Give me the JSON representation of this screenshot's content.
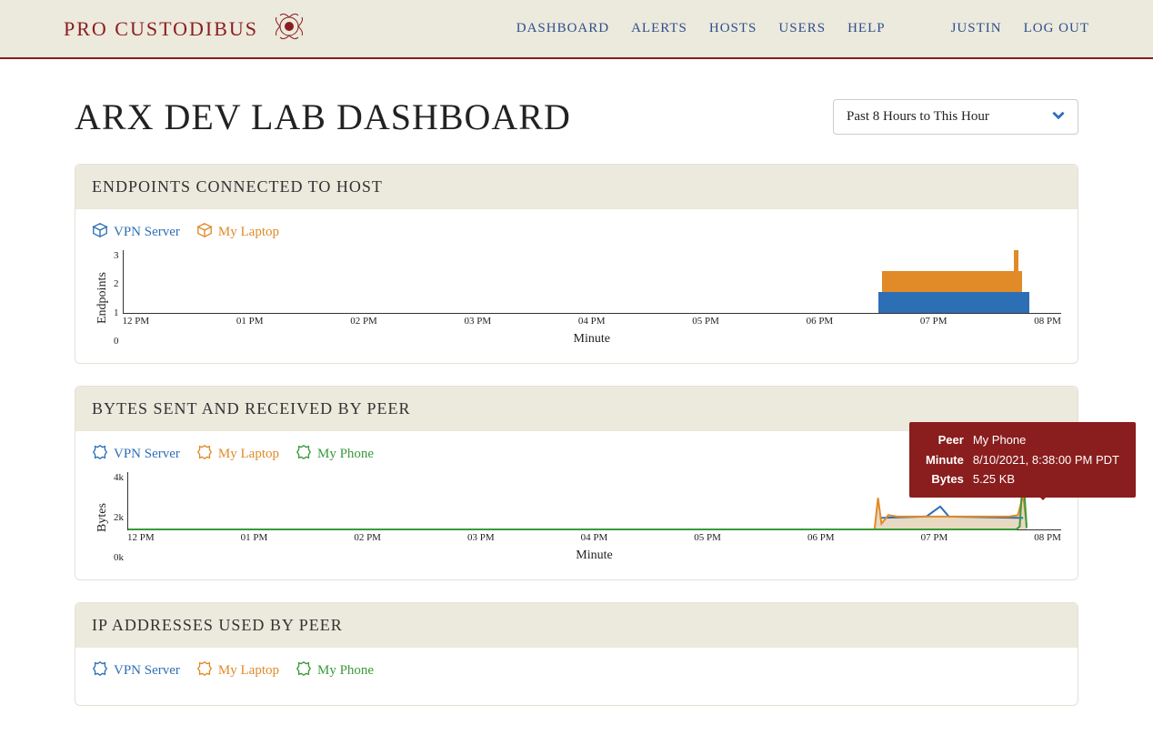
{
  "header": {
    "brand": "PRO CUSTODIBUS",
    "nav": [
      "DASHBOARD",
      "ALERTS",
      "HOSTS",
      "USERS",
      "HELP"
    ],
    "user": "JUSTIN",
    "logout": "LOG OUT"
  },
  "page": {
    "title": "ARX DEV LAB DASHBOARD",
    "range": "Past 8 Hours to This Hour"
  },
  "panels": {
    "endpoints": {
      "title": "ENDPOINTS CONNECTED TO HOST",
      "legend": [
        {
          "label": "VPN Server",
          "color": "blue"
        },
        {
          "label": "My Laptop",
          "color": "orange"
        }
      ]
    },
    "bytes": {
      "title": "BYTES SENT AND RECEIVED BY PEER",
      "legend": [
        {
          "label": "VPN Server",
          "color": "blue"
        },
        {
          "label": "My Laptop",
          "color": "orange"
        },
        {
          "label": "My Phone",
          "color": "green"
        }
      ]
    },
    "ips": {
      "title": "IP ADDRESSES USED BY PEER",
      "legend": [
        {
          "label": "VPN Server",
          "color": "blue"
        },
        {
          "label": "My Laptop",
          "color": "orange"
        },
        {
          "label": "My Phone",
          "color": "green"
        }
      ]
    }
  },
  "tooltip": {
    "peer_label": "Peer",
    "peer_value": "My Phone",
    "minute_label": "Minute",
    "minute_value": "8/10/2021, 8:38:00 PM PDT",
    "bytes_label": "Bytes",
    "bytes_value": "5.25 KB"
  },
  "chart_data": [
    {
      "type": "bar",
      "title": "Endpoints Connected to Host",
      "xlabel": "Minute",
      "ylabel": "Endpoints",
      "ylim": [
        0,
        3
      ],
      "yticks": [
        0,
        1,
        2,
        3
      ],
      "xticks": [
        "12 PM",
        "01 PM",
        "02 PM",
        "03 PM",
        "04 PM",
        "05 PM",
        "06 PM",
        "07 PM",
        "08 PM"
      ],
      "x_minutes": [
        0,
        60,
        120,
        180,
        240,
        300,
        360,
        420,
        480
      ],
      "series": [
        {
          "name": "VPN Server",
          "color": "#2d6fb5",
          "points": [
            {
              "minute": 435,
              "value": 1
            },
            {
              "minute": 437,
              "value": 1
            },
            {
              "minute": 439,
              "value": 1
            },
            {
              "minute": 441,
              "value": 1
            },
            {
              "minute": 443,
              "value": 1
            },
            {
              "minute": 445,
              "value": 1
            },
            {
              "minute": 447,
              "value": 1
            },
            {
              "minute": 449,
              "value": 1
            },
            {
              "minute": 451,
              "value": 1
            },
            {
              "minute": 453,
              "value": 1
            },
            {
              "minute": 455,
              "value": 1
            },
            {
              "minute": 457,
              "value": 1
            },
            {
              "minute": 459,
              "value": 1
            },
            {
              "minute": 461,
              "value": 1
            },
            {
              "minute": 463,
              "value": 1
            },
            {
              "minute": 465,
              "value": 1
            },
            {
              "minute": 467,
              "value": 1
            },
            {
              "minute": 469,
              "value": 1
            },
            {
              "minute": 471,
              "value": 1
            },
            {
              "minute": 473,
              "value": 1
            },
            {
              "minute": 475,
              "value": 1
            },
            {
              "minute": 477,
              "value": 1
            },
            {
              "minute": 479,
              "value": 1
            },
            {
              "minute": 481,
              "value": 1
            },
            {
              "minute": 483,
              "value": 1
            },
            {
              "minute": 485,
              "value": 1
            },
            {
              "minute": 487,
              "value": 1
            },
            {
              "minute": 489,
              "value": 1
            },
            {
              "minute": 491,
              "value": 1
            },
            {
              "minute": 493,
              "value": 1
            },
            {
              "minute": 495,
              "value": 1
            },
            {
              "minute": 497,
              "value": 1
            },
            {
              "minute": 499,
              "value": 1
            },
            {
              "minute": 501,
              "value": 1
            },
            {
              "minute": 503,
              "value": 1
            },
            {
              "minute": 505,
              "value": 1
            },
            {
              "minute": 507,
              "value": 1
            },
            {
              "minute": 509,
              "value": 1
            },
            {
              "minute": 511,
              "value": 1
            },
            {
              "minute": 513,
              "value": 1
            },
            {
              "minute": 515,
              "value": 1
            },
            {
              "minute": 517,
              "value": 1
            },
            {
              "minute": 519,
              "value": 1
            }
          ]
        },
        {
          "name": "My Laptop",
          "color": "#e08a28",
          "points": [
            {
              "minute": 437,
              "value": 1
            },
            {
              "minute": 439,
              "value": 1
            },
            {
              "minute": 441,
              "value": 1
            },
            {
              "minute": 443,
              "value": 1
            },
            {
              "minute": 445,
              "value": 1
            },
            {
              "minute": 447,
              "value": 1
            },
            {
              "minute": 449,
              "value": 1
            },
            {
              "minute": 451,
              "value": 1
            },
            {
              "minute": 453,
              "value": 1
            },
            {
              "minute": 455,
              "value": 1
            },
            {
              "minute": 457,
              "value": 1
            },
            {
              "minute": 459,
              "value": 1
            },
            {
              "minute": 461,
              "value": 1
            },
            {
              "minute": 463,
              "value": 1
            },
            {
              "minute": 465,
              "value": 1
            },
            {
              "minute": 467,
              "value": 1
            },
            {
              "minute": 469,
              "value": 1
            },
            {
              "minute": 471,
              "value": 1
            },
            {
              "minute": 473,
              "value": 1
            },
            {
              "minute": 475,
              "value": 1
            },
            {
              "minute": 477,
              "value": 1
            },
            {
              "minute": 479,
              "value": 1
            },
            {
              "minute": 481,
              "value": 1
            },
            {
              "minute": 483,
              "value": 1
            },
            {
              "minute": 485,
              "value": 1
            },
            {
              "minute": 487,
              "value": 1
            },
            {
              "minute": 489,
              "value": 1
            },
            {
              "minute": 491,
              "value": 1
            },
            {
              "minute": 493,
              "value": 1
            },
            {
              "minute": 495,
              "value": 1
            },
            {
              "minute": 497,
              "value": 1
            },
            {
              "minute": 499,
              "value": 1
            },
            {
              "minute": 501,
              "value": 1
            },
            {
              "minute": 503,
              "value": 1
            },
            {
              "minute": 505,
              "value": 1
            },
            {
              "minute": 507,
              "value": 1
            },
            {
              "minute": 509,
              "value": 1
            },
            {
              "minute": 511,
              "value": 1
            },
            {
              "minute": 513,
              "value": 2
            },
            {
              "minute": 515,
              "value": 1
            }
          ]
        }
      ]
    },
    {
      "type": "area",
      "title": "Bytes Sent and Received by Peer",
      "xlabel": "Minute",
      "ylabel": "Bytes",
      "ylim": [
        0,
        4000
      ],
      "yticks": [
        "0k",
        "2k",
        "4k"
      ],
      "xticks": [
        "12 PM",
        "01 PM",
        "02 PM",
        "03 PM",
        "04 PM",
        "05 PM",
        "06 PM",
        "07 PM",
        "08 PM"
      ],
      "x_minutes": [
        0,
        60,
        120,
        180,
        240,
        300,
        360,
        420,
        480
      ],
      "series": [
        {
          "name": "VPN Server",
          "color": "#2d6fb5",
          "points": [
            {
              "minute": 435,
              "value": 800
            },
            {
              "minute": 462,
              "value": 900
            },
            {
              "minute": 470,
              "value": 1600
            },
            {
              "minute": 475,
              "value": 900
            },
            {
              "minute": 518,
              "value": 800
            }
          ]
        },
        {
          "name": "My Laptop",
          "color": "#e08a28",
          "points": [
            {
              "minute": 432,
              "value": 0
            },
            {
              "minute": 434,
              "value": 2200
            },
            {
              "minute": 436,
              "value": 400
            },
            {
              "minute": 440,
              "value": 1000
            },
            {
              "minute": 445,
              "value": 900
            },
            {
              "minute": 510,
              "value": 900
            },
            {
              "minute": 515,
              "value": 1000
            },
            {
              "minute": 518,
              "value": 2400
            },
            {
              "minute": 520,
              "value": 300
            }
          ]
        },
        {
          "name": "My Phone",
          "color": "#3a9a3a",
          "points": [
            {
              "minute": 0,
              "value": 0
            },
            {
              "minute": 514,
              "value": 0
            },
            {
              "minute": 516,
              "value": 200
            },
            {
              "minute": 518,
              "value": 5250
            },
            {
              "minute": 520,
              "value": 100
            }
          ]
        }
      ]
    }
  ]
}
